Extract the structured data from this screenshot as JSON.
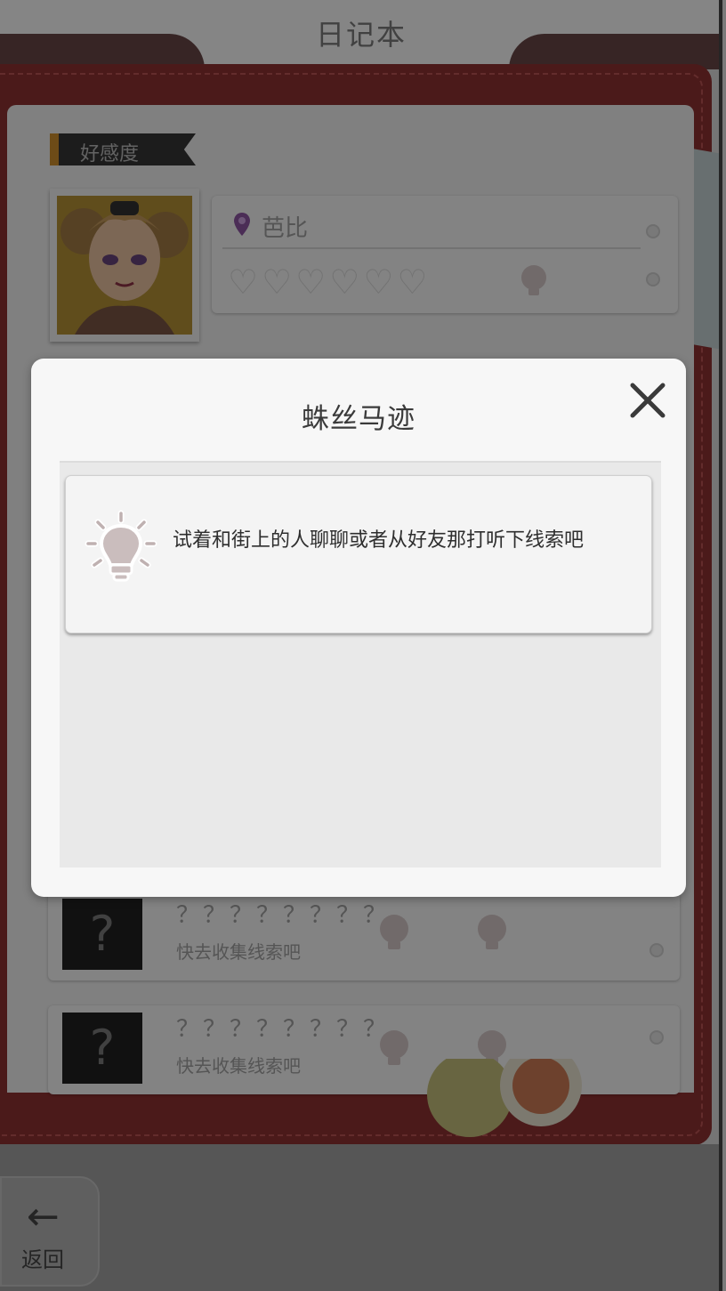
{
  "app": {
    "title": "日记本",
    "section_label": "好感度",
    "character": {
      "name": "芭比",
      "hearts_filled": 0,
      "hearts_total": 6
    },
    "mystery_rows": [
      {
        "title": "？？？？？？？？",
        "hint": "快去收集线索吧"
      },
      {
        "title": "？？？？？？？？",
        "hint": "快去收集线索吧"
      }
    ],
    "back_label": "返回"
  },
  "modal": {
    "title": "蛛丝马迹",
    "clues": [
      {
        "text": "试着和街上的人聊聊或者从好友那打听下线索吧",
        "icon": "lightbulb-icon"
      }
    ]
  },
  "colors": {
    "notebook_red": "#7a2a2a",
    "modal_bg": "#f7f7f7",
    "content_bg": "#e9e9e9",
    "accent_purple": "#a24ad0"
  }
}
